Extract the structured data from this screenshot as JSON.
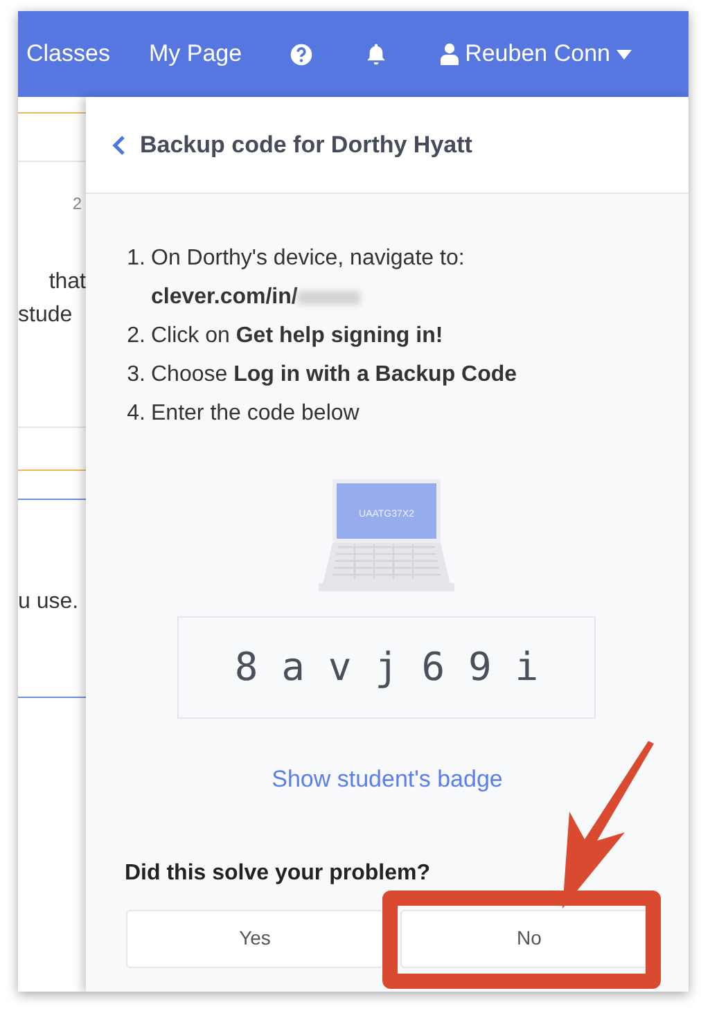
{
  "nav": {
    "links": [
      "Classes",
      "My Page"
    ],
    "user": "Reuben Conn"
  },
  "background_page": {
    "texts": [
      "2",
      "that",
      "stude",
      "u use."
    ]
  },
  "panel": {
    "title": "Backup code for Dorthy Hyatt",
    "steps": [
      {
        "number": "1.",
        "text": "On Dorthy's device, navigate to:",
        "url": "clever.com/in/"
      },
      {
        "number": "2.",
        "text": "Click on **Get help signing in!**"
      },
      {
        "number": "3.",
        "text": "Choose **Log in with a Backup Code**"
      },
      {
        "number": "4.",
        "text": "Enter the code below"
      }
    ],
    "laptop_code": "UAATG37X2",
    "backup_code": "8 a v j 6 9 i",
    "badge_link": "Show student's badge",
    "question": "Did this solve your problem?",
    "answers": [
      {
        "label": "Yes",
        "highlighted": false
      },
      {
        "label": "No",
        "highlighted": true
      }
    ]
  }
}
